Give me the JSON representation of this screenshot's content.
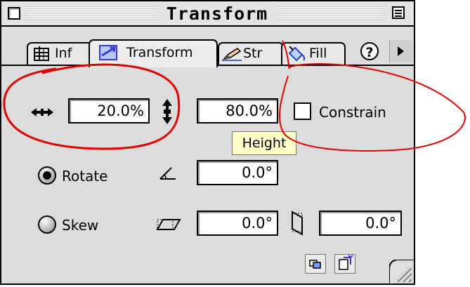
{
  "window": {
    "title": "Transform"
  },
  "tabs": [
    {
      "label": "Inf",
      "icon": "info-grid-icon"
    },
    {
      "label": "Transform",
      "icon": "transform-arrow-icon",
      "active": true
    },
    {
      "label": "Str",
      "icon": "pencil-stroke-icon"
    },
    {
      "label": "Fill",
      "icon": "paint-bucket-icon"
    }
  ],
  "help_label": "?",
  "scale": {
    "width_value": "20.0%",
    "height_value": "80.0%",
    "constrain_label": "Constrain",
    "constrain_checked": false,
    "tooltip": "Height"
  },
  "rotate": {
    "label": "Rotate",
    "selected": true,
    "value": "0.0°"
  },
  "skew": {
    "label": "Skew",
    "selected": false,
    "value_horizontal": "0.0°",
    "value_vertical": "0.0°"
  },
  "footer": {
    "buttons": [
      "copy-transform-icon",
      "apply-transform-icon"
    ]
  },
  "annotations": {
    "color": "#e00000"
  }
}
